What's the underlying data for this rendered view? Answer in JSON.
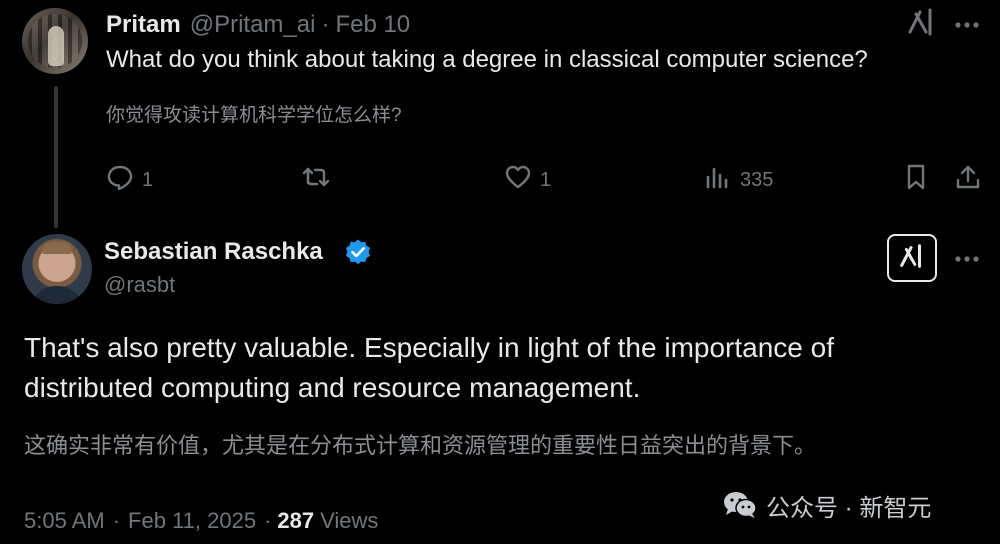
{
  "reply_tweet": {
    "author_name": "Pritam",
    "author_handle": "@Pritam_ai",
    "separator": "·",
    "date": "Feb 10",
    "text": "What do you think about taking a degree in classical computer science?",
    "translation": "你觉得攻读计算机科学学位怎么样?",
    "actions": {
      "reply_count": "1",
      "retweet_count": "",
      "like_count": "1",
      "views_count": "335"
    },
    "icons": [
      "grok-icon",
      "more-icon",
      "reply-icon",
      "retweet-icon",
      "like-icon",
      "views-icon",
      "bookmark-icon",
      "share-icon"
    ]
  },
  "main_tweet": {
    "author_name": "Sebastian Raschka",
    "author_handle": "@rasbt",
    "verified": true,
    "text": "That's also pretty valuable. Especially in light of the importance of distributed computing and resource management.",
    "translation": "这确实非常有价值，尤其是在分布式计算和资源管理的重要性日益突出的背景下。",
    "time": "5:05 AM",
    "separator": "·",
    "date": "Feb 11, 2025",
    "separator2": "·",
    "views_count": "287",
    "views_label": "Views"
  },
  "watermark": {
    "text": "公众号 · 新智元",
    "icon": "wechat-icon"
  },
  "colors": {
    "background": "#000000",
    "primary_text": "#e7e9ea",
    "secondary_text": "#71767b",
    "verified_blue": "#1d9bf0",
    "thread_line": "#333639"
  }
}
